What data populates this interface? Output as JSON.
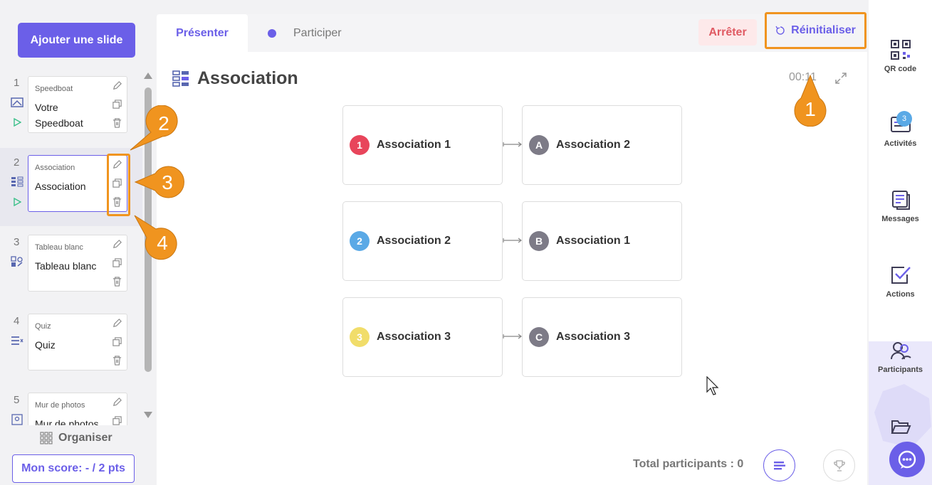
{
  "sidebar": {
    "add_slide": "Ajouter une slide",
    "organise": "Organiser",
    "score": "Mon score: - / 2 pts",
    "slides": [
      {
        "num": "1",
        "type": "Speedboat",
        "title": "Votre Speedboat"
      },
      {
        "num": "2",
        "type": "Association",
        "title": "Association"
      },
      {
        "num": "3",
        "type": "Tableau blanc",
        "title": "Tableau blanc"
      },
      {
        "num": "4",
        "type": "Quiz",
        "title": "Quiz"
      },
      {
        "num": "5",
        "type": "Mur de photos",
        "title": "Mur de photos"
      }
    ]
  },
  "tabs": {
    "present": "Présenter",
    "participate": "Participer"
  },
  "toolbar": {
    "stop": "Arrêter",
    "reset": "Réinitialiser"
  },
  "main": {
    "title": "Association",
    "timer": "00:11",
    "rows": [
      {
        "left_badge": "1",
        "left_label": "Association 1",
        "left_color": "#e8455b",
        "right_badge": "A",
        "right_label": "Association 2"
      },
      {
        "left_badge": "2",
        "left_label": "Association 2",
        "left_color": "#5aa9e6",
        "right_badge": "B",
        "right_label": "Association 1"
      },
      {
        "left_badge": "3",
        "left_label": "Association 3",
        "left_color": "#f1dd6a",
        "right_badge": "C",
        "right_label": "Association 3"
      }
    ],
    "right_badge_color": "#7d7b87",
    "total_participants": "Total participants : 0"
  },
  "right_sidebar": {
    "qr": "QR code",
    "activities": "Activités",
    "activities_count": "3",
    "messages": "Messages",
    "actions": "Actions",
    "participants": "Participants"
  },
  "callouts": [
    "1",
    "2",
    "3",
    "4"
  ],
  "colors": {
    "accent": "#6b5fe8",
    "callout": "#f0941f",
    "stop": "#e05a63"
  }
}
